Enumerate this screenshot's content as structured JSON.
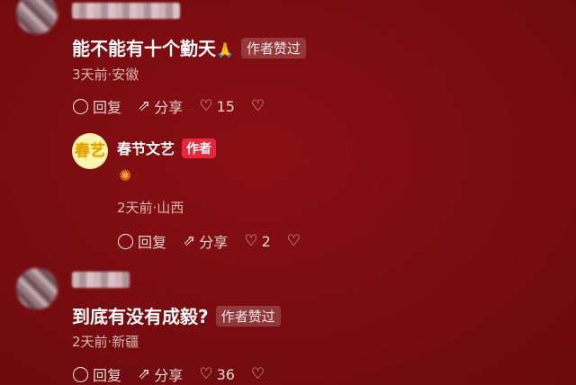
{
  "comments": [
    {
      "text": "能不能有十个勤天",
      "emoji": "🙏",
      "liked_tag": "作者赞过",
      "meta": "3天前·安徽",
      "reply_label": "回复",
      "share_label": "分享",
      "like_count": "15"
    },
    {
      "text": "到底有没有成毅?",
      "liked_tag": "作者赞过",
      "meta": "2天前·新疆",
      "reply_label": "回复",
      "share_label": "分享",
      "like_count": "36"
    }
  ],
  "reply": {
    "author_name": "春节文艺",
    "author_badge": "作者",
    "avatar_logo": "春艺",
    "sticker": "✺",
    "meta": "2天前·山西",
    "reply_label": "回复",
    "share_label": "分享",
    "like_count": "2"
  },
  "icons": {
    "reply": "reply-bubble-icon",
    "share": "share-arrow-icon",
    "like": "heart-icon",
    "dislike": "broken-heart-icon"
  },
  "colors": {
    "background": "#780c10",
    "author_badge": "#e8263c",
    "meta_text": "#d9b6b6"
  }
}
